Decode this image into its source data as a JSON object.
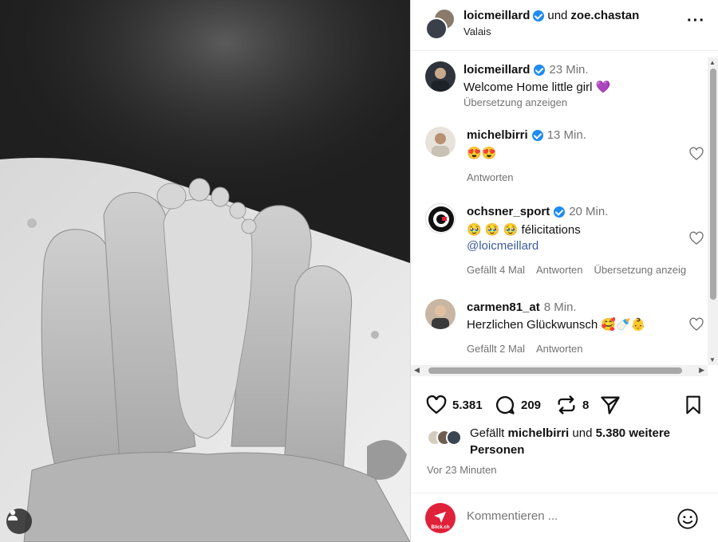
{
  "post": {
    "author": "loicmeillard",
    "connector": "und",
    "coauthor": "zoe.chastan",
    "location": "Valais",
    "more_icon": "more-horizontal-icon",
    "caption": {
      "author": "loicmeillard",
      "time": "23 Min.",
      "text": "Welcome Home little girl 💜",
      "translate": "Übersetzung anzeigen"
    }
  },
  "comments": [
    {
      "username": "michelbirri",
      "verified": true,
      "time": "13 Min.",
      "text": "😍😍",
      "reply": "Antworten"
    },
    {
      "username": "ochsner_sport",
      "verified": true,
      "time": "20 Min.",
      "text": "🥹 🥹 🥹  félicitations",
      "mention": "@loicmeillard",
      "likes": "Gefällt 4 Mal",
      "reply": "Antworten",
      "translate": "Übersetzung anzeig"
    },
    {
      "username": "carmen81_at",
      "verified": false,
      "time": "8 Min.",
      "text": "Herzlichen Glückwunsch 🥰🍼👶",
      "likes": "Gefällt 2 Mal",
      "reply": "Antworten"
    }
  ],
  "actions": {
    "likes_count": "5.381",
    "comments_count": "209",
    "reposts_count": "8"
  },
  "liked_by": {
    "prefix": "Gefällt",
    "user": "michelbirri",
    "mid": "und",
    "others": "5.380 weitere Personen"
  },
  "posted_ago": "Vor 23 Minuten",
  "comment_input": {
    "placeholder": "Kommentieren ...",
    "avatar_text": "Blick.ch"
  },
  "colors": {
    "verified": "#1d8cf0",
    "mention": "#3b5b9e",
    "muted": "#737373",
    "blick_red": "#e0213a"
  }
}
